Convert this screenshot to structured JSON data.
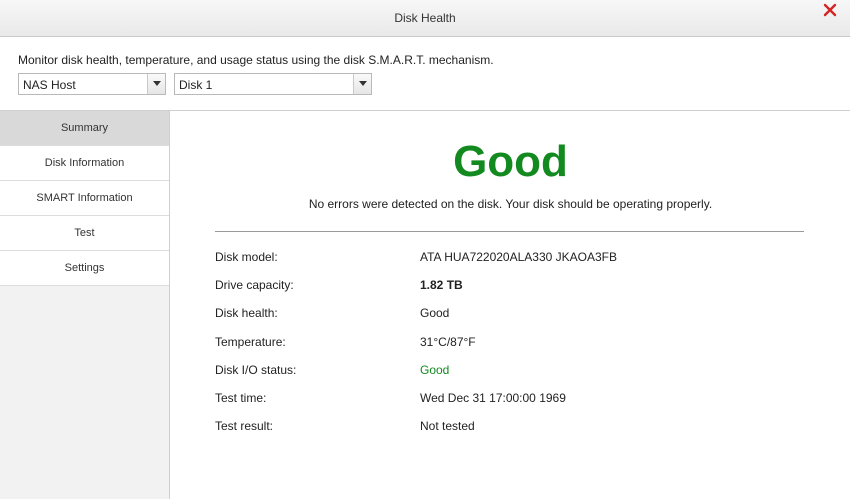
{
  "window": {
    "title": "Disk Health"
  },
  "description": "Monitor disk health, temperature, and usage status using the disk S.M.A.R.T. mechanism.",
  "selectors": {
    "host": "NAS Host",
    "disk": "Disk 1"
  },
  "sidebar": {
    "items": [
      {
        "label": "Summary"
      },
      {
        "label": "Disk Information"
      },
      {
        "label": "SMART Information"
      },
      {
        "label": "Test"
      },
      {
        "label": "Settings"
      }
    ]
  },
  "summary": {
    "status": "Good",
    "message": "No errors were detected on the disk. Your disk should be operating properly.",
    "fields": [
      {
        "key": "Disk model:",
        "value": "ATA HUA722020ALA330 JKAOA3FB"
      },
      {
        "key": "Drive capacity:",
        "value": "1.82 TB"
      },
      {
        "key": "Disk health:",
        "value": "Good"
      },
      {
        "key": "Temperature:",
        "value": "31°C/87°F"
      },
      {
        "key": "Disk I/O status:",
        "value": "Good"
      },
      {
        "key": "Test time:",
        "value": "Wed Dec 31 17:00:00 1969"
      },
      {
        "key": "Test result:",
        "value": "Not tested"
      }
    ]
  },
  "colors": {
    "good": "#138a1f",
    "close": "#d42424",
    "active_tab": "#d9d9d9"
  },
  "icons": {
    "close": "close-icon",
    "dropdown": "chevron-down-icon"
  }
}
